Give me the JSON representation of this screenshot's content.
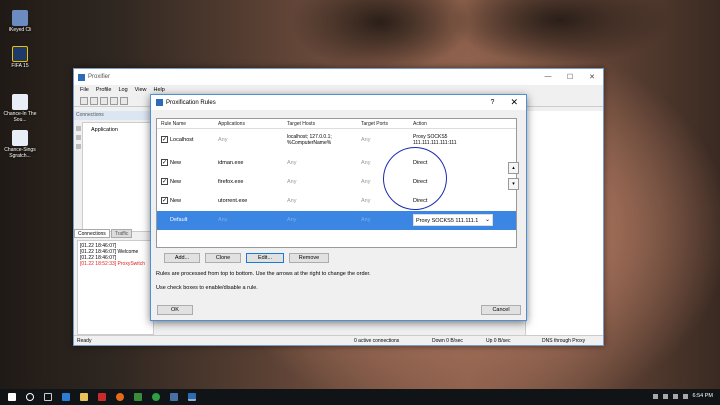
{
  "desktop": {
    "icons": [
      {
        "label": "IKeyed Cli",
        "icon": "app-icon"
      },
      {
        "label": "FIFA 15",
        "icon": "fifa-icon"
      },
      {
        "label": "Chance-In The Sou...",
        "icon": "document-icon"
      },
      {
        "label": "Chance-Sings Sgratch...",
        "icon": "document-icon"
      }
    ]
  },
  "main_window": {
    "title": "Proxifier",
    "menu": [
      "File",
      "Profile",
      "Log",
      "View",
      "Help"
    ],
    "connections_label": "Connections",
    "application_column": "Application",
    "tabs": [
      "Connections",
      "Traffic"
    ],
    "log_lines": [
      {
        "text": "[01.22 18:46:07]",
        "color": "#000000"
      },
      {
        "text": "[01.22 18:46:07] Welcome",
        "color": "#000000"
      },
      {
        "text": "[01.22 18:46:07]",
        "color": "#000000"
      },
      {
        "text": "[01.22 18:52:33] ProxySwitch",
        "color": "#e02020"
      }
    ],
    "status": {
      "ready": "Ready",
      "active": "0 active connections",
      "down": "Down 0 B/sec",
      "up": "Up 0 B/sec",
      "dns": "DNS through Proxy"
    }
  },
  "dialog": {
    "title": "Proxification Rules",
    "help": "?",
    "close": "✕",
    "columns": [
      "Rule Name",
      "Applications",
      "Target Hosts",
      "Target Ports",
      "Action"
    ],
    "rules": [
      {
        "checked": true,
        "name": "Localhost",
        "apps": "Any",
        "hosts": "localhost; 127.0.0.1; %ComputerName%",
        "ports": "Any",
        "action": "Proxy SOCKS5 111.111.111.111:111"
      },
      {
        "checked": true,
        "name": "New",
        "apps": "idman.exe",
        "hosts": "Any",
        "ports": "Any",
        "action": "Direct"
      },
      {
        "checked": true,
        "name": "New",
        "apps": "firefox.exe",
        "hosts": "Any",
        "ports": "Any",
        "action": "Direct"
      },
      {
        "checked": true,
        "name": "New",
        "apps": "utorrent.exe",
        "hosts": "Any",
        "ports": "Any",
        "action": "Direct"
      }
    ],
    "default_rule": {
      "name": "Default",
      "apps": "Any",
      "hosts": "Any",
      "ports": "Any",
      "action": "Proxy SOCKS5 111.111.1"
    },
    "buttons": {
      "add": "Add...",
      "clone": "Clone",
      "edit": "Edit...",
      "remove": "Remove",
      "ok": "OK",
      "cancel": "Cancel"
    },
    "note1": "Rules are processed from top to bottom. Use the arrows at the right to change the order.",
    "note2": "Use check boxes to enable/disable a rule.",
    "highlight_color": "#3a86e2"
  },
  "taskbar": {
    "time": "6:54 PM"
  }
}
